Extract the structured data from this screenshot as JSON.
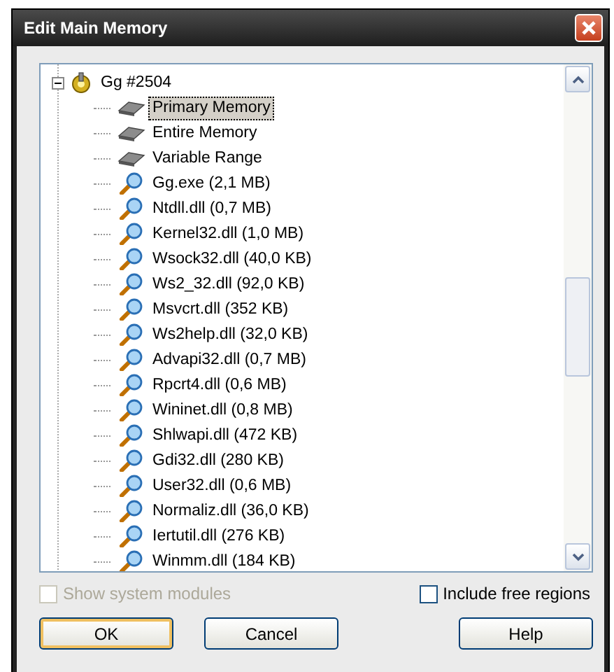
{
  "window": {
    "title": "Edit Main Memory"
  },
  "tree": {
    "label": "Gg #2504",
    "expanded": true,
    "children": [
      {
        "label": "Primary Memory",
        "kind": "memory",
        "selected": true
      },
      {
        "label": "Entire Memory",
        "kind": "memory",
        "selected": false
      },
      {
        "label": "Variable Range",
        "kind": "memory",
        "selected": false
      },
      {
        "label": "Gg.exe (2,1 MB)",
        "kind": "module",
        "selected": false
      },
      {
        "label": "Ntdll.dll (0,7 MB)",
        "kind": "module",
        "selected": false
      },
      {
        "label": "Kernel32.dll (1,0 MB)",
        "kind": "module",
        "selected": false
      },
      {
        "label": "Wsock32.dll (40,0 KB)",
        "kind": "module",
        "selected": false
      },
      {
        "label": "Ws2_32.dll (92,0 KB)",
        "kind": "module",
        "selected": false
      },
      {
        "label": "Msvcrt.dll (352 KB)",
        "kind": "module",
        "selected": false
      },
      {
        "label": "Ws2help.dll (32,0 KB)",
        "kind": "module",
        "selected": false
      },
      {
        "label": "Advapi32.dll (0,7 MB)",
        "kind": "module",
        "selected": false
      },
      {
        "label": "Rpcrt4.dll (0,6 MB)",
        "kind": "module",
        "selected": false
      },
      {
        "label": "Wininet.dll (0,8 MB)",
        "kind": "module",
        "selected": false
      },
      {
        "label": "Shlwapi.dll (472 KB)",
        "kind": "module",
        "selected": false
      },
      {
        "label": "Gdi32.dll (280 KB)",
        "kind": "module",
        "selected": false
      },
      {
        "label": "User32.dll (0,6 MB)",
        "kind": "module",
        "selected": false
      },
      {
        "label": "Normaliz.dll (36,0 KB)",
        "kind": "module",
        "selected": false
      },
      {
        "label": "Iertutil.dll (276 KB)",
        "kind": "module",
        "selected": false
      },
      {
        "label": "Winmm.dll (184 KB)",
        "kind": "module",
        "selected": false
      }
    ]
  },
  "options": [
    {
      "label": "Show system modules",
      "checked": false,
      "disabled": true
    },
    {
      "label": "Include free regions",
      "checked": false,
      "disabled": false
    }
  ],
  "buttons": [
    {
      "label": "OK",
      "default": true
    },
    {
      "label": "Cancel",
      "default": false
    },
    {
      "label": "Help",
      "default": false
    }
  ]
}
